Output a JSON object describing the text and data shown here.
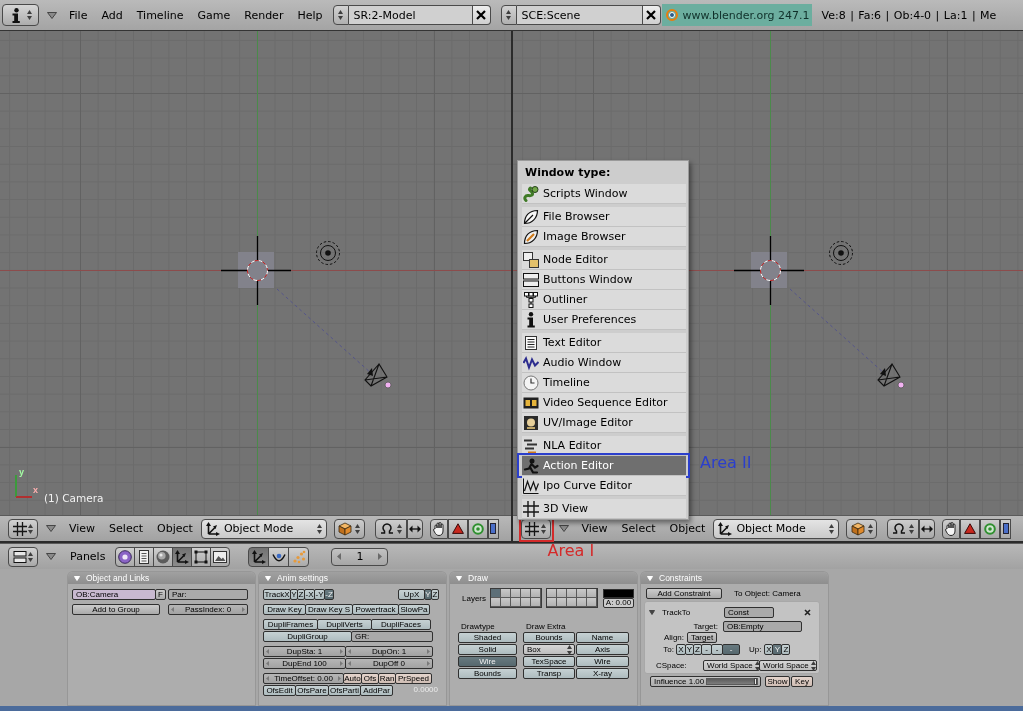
{
  "top_header": {
    "menus": [
      "File",
      "Add",
      "Timeline",
      "Game",
      "Render",
      "Help"
    ],
    "screen": "SR:2-Model",
    "scene": "SCE:Scene",
    "version": "www.blender.org 247.1",
    "stats": "Ve:8 | Fa:6 | Ob:4-0 | La:1 | Me"
  },
  "viewports": [
    {
      "object_label": "(1) Camera",
      "axis_labels": {
        "x": "x",
        "y": "y"
      },
      "header": {
        "menus": [
          "View",
          "Select",
          "Object"
        ],
        "mode": "Object Mode"
      }
    },
    {
      "header": {
        "menus": [
          "View",
          "Select",
          "Object"
        ],
        "mode": "Object Mode",
        "annotation": {
          "label": "Area I",
          "color": "#d42a2a"
        }
      }
    }
  ],
  "window_type_menu": {
    "title": "Window type:",
    "groups": [
      [
        {
          "label": "Scripts Window",
          "selected": false
        }
      ],
      [
        {
          "label": "File Browser",
          "selected": false
        },
        {
          "label": "Image Browser",
          "selected": false
        }
      ],
      [
        {
          "label": "Node Editor",
          "selected": false
        },
        {
          "label": "Buttons Window",
          "selected": false
        },
        {
          "label": "Outliner",
          "selected": false
        },
        {
          "label": "User Preferences",
          "selected": false
        }
      ],
      [
        {
          "label": "Text Editor",
          "selected": false
        },
        {
          "label": "Audio Window",
          "selected": false
        },
        {
          "label": "Timeline",
          "selected": false
        },
        {
          "label": "Video Sequence Editor",
          "selected": false
        },
        {
          "label": "UV/Image Editor",
          "selected": false
        }
      ],
      [
        {
          "label": "NLA Editor",
          "selected": false
        },
        {
          "label": "Action Editor",
          "selected": true,
          "annotation": {
            "label": "Area II",
            "color": "#2b3fcc"
          }
        },
        {
          "label": "Ipo Curve Editor",
          "selected": false
        }
      ],
      [
        {
          "label": "3D View",
          "selected": false
        }
      ]
    ]
  },
  "buttons_window": {
    "header": {
      "panels_menu": "Panels",
      "contexts": [
        {
          "selected": false
        },
        {
          "selected": false
        },
        {
          "selected": false
        },
        {
          "selected": true
        },
        {
          "selected": false
        },
        {
          "selected": false
        }
      ],
      "subcontexts": [
        {
          "selected": true
        },
        {
          "selected": false
        },
        {
          "selected": false
        }
      ],
      "frame": "1"
    },
    "panels": [
      {
        "kind": "rows",
        "title": "Object and Links",
        "blocks": [
          [
            [
              [
                {
                  "kind": "id",
                  "value": "OB:Camera"
                },
                {
                  "kind": "button",
                  "label": "F"
                }
              ],
              [
                {
                  "kind": "text",
                  "value": "Par:"
                }
              ]
            ]
          ],
          [
            [
              [
                {
                  "kind": "button",
                  "label": "Add to Group"
                }
              ],
              [
                {
                  "kind": "number",
                  "value": "PassIndex: 0"
                }
              ]
            ]
          ]
        ]
      },
      {
        "kind": "rows",
        "title": "Anim settings",
        "blocks": [
          [
            [
              [
                {
                  "kind": "radio",
                  "label": "TrackX",
                  "selected": false
                },
                {
                  "kind": "radio",
                  "label": "Y",
                  "selected": false
                },
                {
                  "kind": "radio",
                  "label": "Z",
                  "selected": false
                },
                {
                  "kind": "radio",
                  "label": "-X",
                  "selected": false
                },
                {
                  "kind": "radio",
                  "label": "-Y",
                  "selected": false
                },
                {
                  "kind": "radio",
                  "label": "-Z",
                  "selected": true
                }
              ],
              [
                {
                  "kind": "radio",
                  "label": "UpX",
                  "selected": false
                },
                {
                  "kind": "radio",
                  "label": "Y",
                  "selected": true
                },
                {
                  "kind": "radio",
                  "label": "Z",
                  "selected": false
                }
              ]
            ]
          ],
          [
            [
              [
                {
                  "kind": "toggle",
                  "label": "Draw Key",
                  "on": false
                },
                {
                  "kind": "toggle",
                  "label": "Draw Key S",
                  "on": false
                },
                {
                  "kind": "toggle",
                  "label": "Powertrack",
                  "on": false
                },
                {
                  "kind": "toggle",
                  "label": "SlowPa",
                  "on": false
                }
              ]
            ]
          ],
          [
            [
              [
                {
                  "kind": "toggle",
                  "label": "DupliFrames",
                  "on": false
                },
                {
                  "kind": "toggle",
                  "label": "DupliVerts",
                  "on": false
                },
                {
                  "kind": "toggle",
                  "label": "DupliFaces",
                  "on": false
                }
              ]
            ],
            [
              [
                {
                  "kind": "toggle",
                  "label": "DupliGroup",
                  "on": false
                },
                {
                  "kind": "text",
                  "value": "GR:"
                }
              ]
            ]
          ],
          [
            [
              [
                {
                  "kind": "number",
                  "value": "DupSta: 1"
                },
                {
                  "kind": "number",
                  "value": "DupOn: 1"
                }
              ]
            ],
            [
              [
                {
                  "kind": "number",
                  "value": "DupEnd 100"
                },
                {
                  "kind": "number",
                  "value": "DupOff 0"
                }
              ]
            ]
          ],
          [
            [
              [
                {
                  "kind": "number",
                  "value": "TimeOffset: 0.00"
                },
                {
                  "kind": "option",
                  "label": "Auto",
                  "on": false
                },
                {
                  "kind": "option",
                  "label": "Ofs",
                  "on": false
                },
                {
                  "kind": "option",
                  "label": "Ran",
                  "on": false
                },
                {
                  "kind": "option",
                  "label": "PrSpeed",
                  "on": false
                }
              ]
            ],
            [
              [
                {
                  "kind": "toggle",
                  "label": "OfsEdit",
                  "on": false
                },
                {
                  "kind": "toggle",
                  "label": "OfsPare",
                  "on": false
                },
                {
                  "kind": "toggle",
                  "label": "OfsParti",
                  "on": false
                },
                {
                  "kind": "toggle",
                  "label": "AddPar",
                  "on": false
                }
              ],
              [
                {
                  "kind": "readout",
                  "value": "0.0000"
                }
              ]
            ]
          ]
        ]
      },
      {
        "kind": "draw",
        "title": "Draw",
        "layers_label": "Layers",
        "layers": [
          {
            "on": true
          },
          {
            "on": false
          },
          {
            "on": false
          },
          {
            "on": false
          },
          {
            "on": false
          },
          {
            "on": false
          },
          {
            "on": false
          },
          {
            "on": false
          },
          {
            "on": false
          },
          {
            "on": false
          },
          {
            "on": false
          },
          {
            "on": false
          },
          {
            "on": false
          },
          {
            "on": false
          },
          {
            "on": false
          },
          {
            "on": false
          },
          {
            "on": false
          },
          {
            "on": false
          },
          {
            "on": false
          },
          {
            "on": false
          }
        ],
        "color": "#000000",
        "alpha": "A: 0.00",
        "drawtype": {
          "label": "Drawtype",
          "options": [
            {
              "label": "Shaded",
              "selected": false
            },
            {
              "label": "Solid",
              "selected": false
            },
            {
              "label": "Wire",
              "selected": true
            },
            {
              "label": "Bounds",
              "selected": false
            }
          ]
        },
        "extra": {
          "label": "Draw Extra",
          "controls": [
            {
              "kind": "toggle",
              "label": "Bounds",
              "on": false
            },
            {
              "kind": "toggle",
              "label": "Name",
              "on": false
            },
            {
              "kind": "menu",
              "value": "Box"
            },
            {
              "kind": "toggle",
              "label": "Axis",
              "on": false
            },
            {
              "kind": "toggle",
              "label": "TexSpace",
              "on": false
            },
            {
              "kind": "toggle",
              "label": "Wire",
              "on": false
            },
            {
              "kind": "toggle",
              "label": "Transp",
              "on": false
            },
            {
              "kind": "toggle",
              "label": "X-ray",
              "on": false
            }
          ]
        }
      },
      {
        "kind": "constraints",
        "title": "Constraints",
        "add_button": "Add Constraint",
        "owner": "To Object: Camera",
        "items": [
          {
            "title": "TrackTo",
            "expanded": true,
            "name": "Const",
            "target_label": "Target:",
            "target": "OB:Empty",
            "align_label": "Align:",
            "align": "Target",
            "to_label": "To:",
            "to": [
              {
                "label": "X",
                "selected": false
              },
              {
                "label": "Y",
                "selected": false
              },
              {
                "label": "Z",
                "selected": false
              },
              {
                "label": "-",
                "selected": false
              },
              {
                "label": "-",
                "selected": false
              },
              {
                "label": "-",
                "selected": true
              }
            ],
            "up_label": "Up:",
            "up": [
              {
                "label": "X",
                "selected": false
              },
              {
                "label": "Y",
                "selected": true
              },
              {
                "label": "Z",
                "selected": false
              }
            ],
            "space_label": "CSpace:",
            "spaces": [
              "World Space",
              "World Space"
            ],
            "influence": {
              "label": "Influence 1.00",
              "level": 1
            },
            "actions": [
              "Show",
              "Key"
            ]
          }
        ]
      }
    ]
  }
}
